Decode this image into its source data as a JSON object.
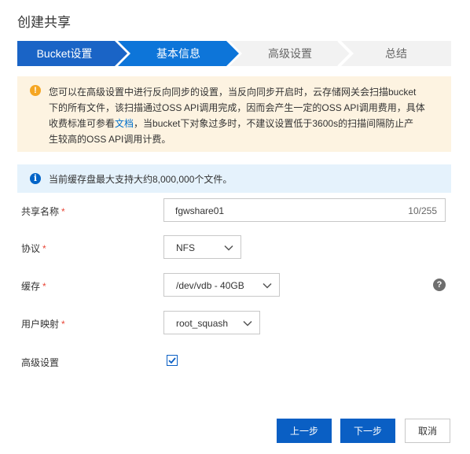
{
  "dialog": {
    "title": "创建共享"
  },
  "steps": [
    {
      "label": "Bucket设置",
      "state": "done"
    },
    {
      "label": "基本信息",
      "state": "active"
    },
    {
      "label": "高级设置",
      "state": "todo"
    },
    {
      "label": "总结",
      "state": "todo"
    }
  ],
  "colors": {
    "step_done": "#1a64c6",
    "step_active": "#0d75d9",
    "step_todo": "#f2f2f2",
    "primary": "#0a5fc4",
    "warning_bg": "#fdf3e1",
    "info_bg": "#e5f2fc",
    "required": "#e84738"
  },
  "warning": {
    "icon": "warning-icon",
    "line1": "您可以在高级设置中进行反向同步的设置，当反向同步开启时，云存储网关会扫描bucket",
    "line2": "下的所有文件，该扫描通过OSS API调用完成，因而会产生一定的OSS API调用费用，具体",
    "line3_before": "收费标准可参看",
    "line3_link": "文档",
    "line3_after": "，当bucket下对象过多时，不建议设置低于3600s的扫描间隔防止产",
    "line4": "生较高的OSS API调用计费。"
  },
  "info": {
    "icon": "info-icon",
    "text": "当前缓存盘最大支持大约8,000,000个文件。"
  },
  "form": {
    "share_name": {
      "label": "共享名称",
      "required_mark": "*",
      "value": "fgwshare01",
      "count": "10/255"
    },
    "protocol": {
      "label": "协议",
      "required_mark": "*",
      "value": "NFS"
    },
    "cache": {
      "label": "缓存",
      "required_mark": "*",
      "value": "/dev/vdb - 40GB",
      "help_icon": "question-icon"
    },
    "user_mapping": {
      "label": "用户映射",
      "required_mark": "*",
      "value": "root_squash"
    },
    "advanced": {
      "label": "高级设置",
      "checked": true
    }
  },
  "buttons": {
    "prev": "上一步",
    "next": "下一步",
    "cancel": "取消"
  }
}
